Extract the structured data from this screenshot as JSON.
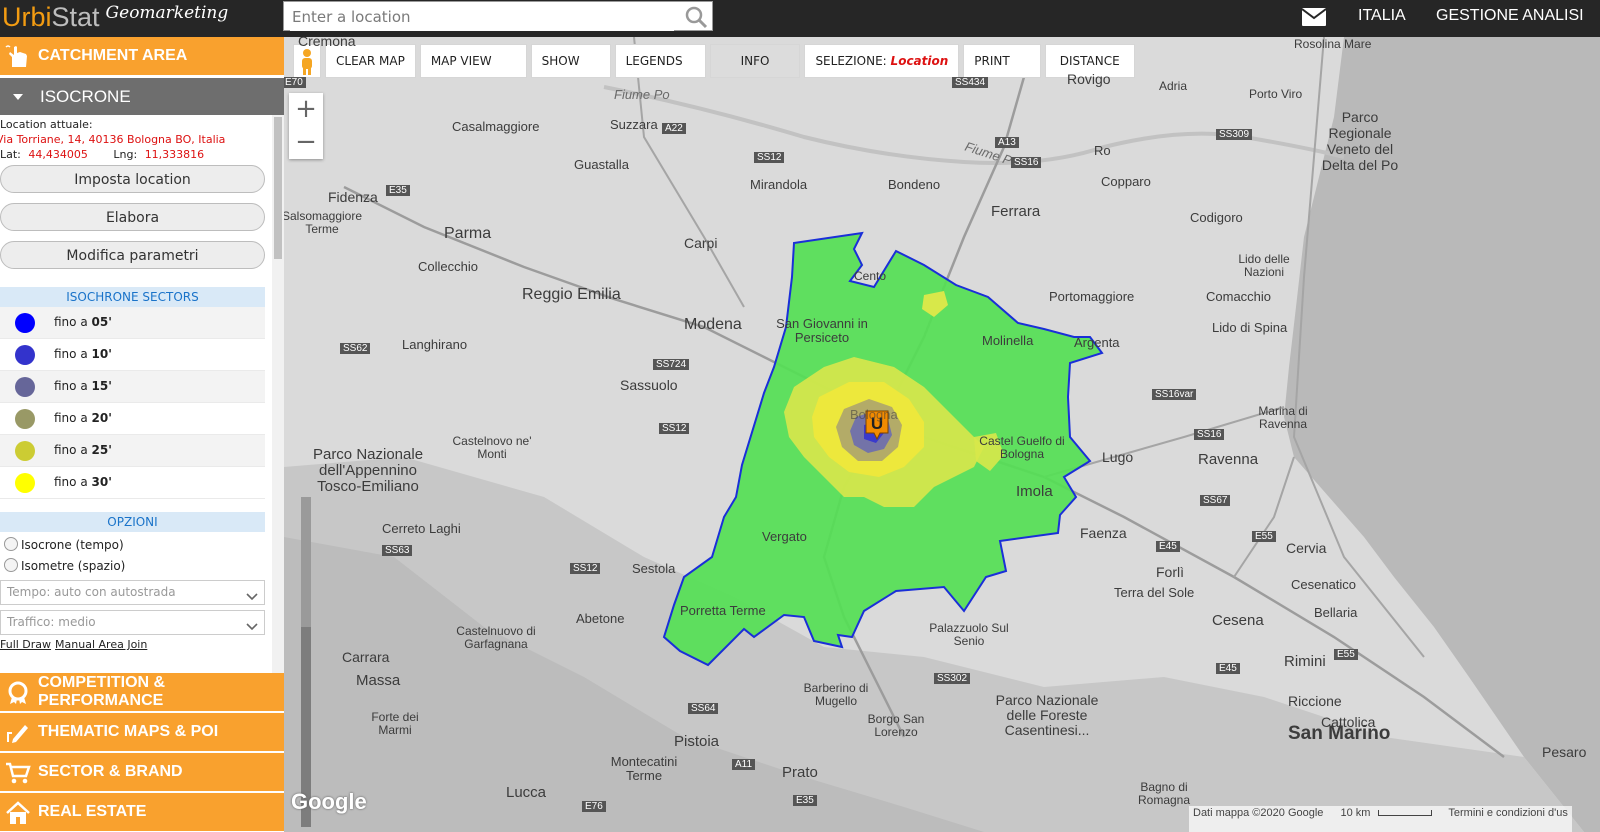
{
  "header": {
    "logo_part1": "Urbi",
    "logo_part2": "Stat",
    "logo_part3": "Geomarketing",
    "search_placeholder": "Enter a location",
    "nav": [
      "ITALIA",
      "GESTIONE ANALISI"
    ]
  },
  "sidebar": {
    "catchment_label": "CATCHMENT AREA",
    "isocrone_label": "ISOCRONE",
    "location_title": "Location attuale:",
    "location_address": "Via Torriane, 14, 40136 Bologna BO, Italia",
    "lat_label": "Lat:",
    "lat_value": "44,434005",
    "lng_label": "Lng:",
    "lng_value": "11,333816",
    "buttons": [
      "Imposta location",
      "Elabora",
      "Modifica parametri"
    ],
    "sectors_title": "ISOCHRONE SECTORS",
    "sectors": [
      {
        "prefix": "fino a",
        "value": "05'",
        "color": "#0000ff"
      },
      {
        "prefix": "fino a",
        "value": "10'",
        "color": "#3333cc"
      },
      {
        "prefix": "fino a",
        "value": "15'",
        "color": "#666699"
      },
      {
        "prefix": "fino a",
        "value": "20'",
        "color": "#999966"
      },
      {
        "prefix": "fino a",
        "value": "25'",
        "color": "#cccc33"
      },
      {
        "prefix": "fino a",
        "value": "30'",
        "color": "#ffff00"
      }
    ],
    "options_title": "OPZIONI",
    "radio_options": [
      "Isocrone (tempo)",
      "Isometre (spazio)"
    ],
    "select_tempo": "Tempo: auto con autostrada",
    "select_traffico": "Traffico: medio",
    "links": [
      "Full Draw",
      "Manual Area Join"
    ],
    "bottom_sections": [
      "COMPETITION & PERFORMANCE",
      "THEMATIC MAPS & POI",
      "SECTOR & BRAND",
      "REAL ESTATE"
    ]
  },
  "map": {
    "toolbar": [
      "CLEAR MAP",
      "MAP VIEW",
      "SHOW",
      "LEGENDS",
      "INFO"
    ],
    "selection_label": "SELEZIONE:",
    "selection_value": "Location",
    "toolbar_right": [
      "PRINT",
      "DISTANCE"
    ],
    "zoom_in": "+",
    "zoom_out": "−",
    "marker_letter": "U",
    "google": "Google",
    "attribution": "Dati mappa ©2020 Google",
    "scale": "10 km",
    "terms": "Termini e condizioni d'us",
    "places": [
      "Cremona",
      "Rosolina Mare",
      "Rovigo",
      "Adria",
      "Porto Viro",
      "Parco Regionale Veneto del Delta del Po",
      "Fiume Po",
      "Casalmaggiore",
      "Suzzara",
      "Guastalla",
      "Mirandola",
      "Bondeno",
      "Fiume Po",
      "Ro",
      "Copparo",
      "Ferrara",
      "Codigoro",
      "Fidenza",
      "Salsomaggiore Terme",
      "Parma",
      "Carpi",
      "Cento",
      "Lido delle Nazioni",
      "Portomaggiore",
      "Comacchio",
      "Collecchio",
      "Reggio Emilia",
      "Modena",
      "San Giovanni in Persiceto",
      "Lido di Spina",
      "Molinella",
      "Argenta",
      "Langhirano",
      "Sassuolo",
      "Castelnovo ne' Monti",
      "Bologna",
      "Castel Guelfo di Bologna",
      "Lugo",
      "Ravenna",
      "Marina di Ravenna",
      "Parco Nazionale dell'Appennino Tosco-Emiliano",
      "Imola",
      "Cerreto Laghi",
      "Faenza",
      "Vergato",
      "Sestola",
      "Cervia",
      "Forlì",
      "Cesenatico",
      "Terra del Sole",
      "Bellaria",
      "Porretta Terme",
      "Abetone",
      "Cesena",
      "Castelnuovo di Garfagnana",
      "Palazzuolo Sul Senio",
      "Rimini",
      "Carrara",
      "Massa",
      "Barberino di Mugello",
      "Parco Nazionale delle Foreste Casentinesi...",
      "Riccione",
      "Forte dei Marmi",
      "Borgo San Lorenzo",
      "Cattolica",
      "San Marino",
      "Pistoia",
      "Montecatini Terme",
      "Prato",
      "Lucca",
      "Bagno di Romagna",
      "Pesaro"
    ],
    "roads": [
      "A22",
      "SS12",
      "A13",
      "SS16",
      "SS434",
      "SS309",
      "E35",
      "SS62",
      "SS724",
      "SS12",
      "SS16var",
      "SS16",
      "SS67",
      "E45",
      "E55",
      "SS63",
      "SS12",
      "SS302",
      "E45",
      "E55",
      "SS64",
      "A11",
      "E76",
      "E35",
      "E70"
    ]
  }
}
